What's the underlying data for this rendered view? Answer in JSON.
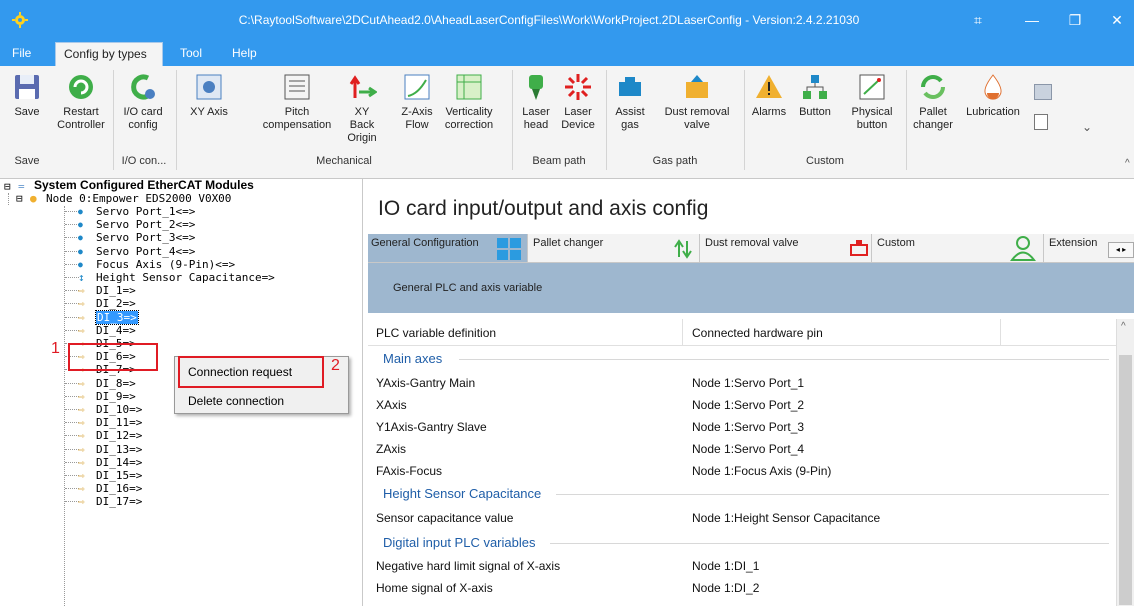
{
  "window": {
    "title": "C:\\RaytoolSoftware\\2DCutAhead2.0\\AheadLaserConfigFiles\\Work\\WorkProject.2DLaserConfig - Version:2.4.2.21030"
  },
  "menu": [
    "File",
    "Config by types",
    "Tool",
    "Help"
  ],
  "ribbon": {
    "buttons": [
      {
        "label": "Save",
        "icon": "save-icon"
      },
      {
        "label": "Restart Controller",
        "icon": "restart-icon"
      },
      {
        "label": "I/O card config",
        "icon": "io-card-icon"
      },
      {
        "label": "XY Axis",
        "icon": "xy-axis-icon"
      },
      {
        "label": "Pitch compensation",
        "icon": "pitch-icon"
      },
      {
        "label": "XY Back Origin",
        "icon": "back-origin-icon"
      },
      {
        "label": "Z-Axis Flow",
        "icon": "z-axis-icon"
      },
      {
        "label": "Verticality correction",
        "icon": "verticality-icon"
      },
      {
        "label": "Laser head",
        "icon": "laser-head-icon"
      },
      {
        "label": "Laser Device",
        "icon": "laser-device-icon"
      },
      {
        "label": "Assist gas",
        "icon": "assist-gas-icon"
      },
      {
        "label": "Dust removal valve",
        "icon": "dust-valve-icon"
      },
      {
        "label": "Alarms",
        "icon": "alarm-icon"
      },
      {
        "label": "Button",
        "icon": "button-icon"
      },
      {
        "label": "Physical button",
        "icon": "physical-button-icon"
      },
      {
        "label": "Pallet changer",
        "icon": "pallet-icon"
      },
      {
        "label": "Lubrication",
        "icon": "lubrication-icon"
      }
    ],
    "groups": [
      "Save",
      "I/O con...",
      "Mechanical",
      "Beam path",
      "Gas path",
      "Custom"
    ]
  },
  "tree": {
    "root": "System Configured EtherCAT Modules",
    "node": "Node 0:Empower EDS2000 V0X00",
    "items": [
      "Servo Port_1<=>",
      "Servo Port_2<=>",
      "Servo Port_3<=>",
      "Servo Port_4<=>",
      "Focus Axis (9-Pin)<=>",
      "Height Sensor Capacitance=>",
      "DI_1=>",
      "DI_2=>",
      "DI_3=>",
      "DI_4=>",
      "DI_5=>",
      "DI_6=>",
      "DI_7=>",
      "DI_8=>",
      "DI_9=>",
      "DI_10=>",
      "DI_11=>",
      "DI_12=>",
      "DI_13=>",
      "DI_14=>",
      "DI_15=>",
      "DI_16=>",
      "DI_17=>"
    ]
  },
  "context_menu": {
    "items": [
      "Connection request",
      "Delete connection"
    ]
  },
  "annotations": {
    "n1": "1",
    "n2": "2"
  },
  "panel": {
    "title": "IO card input/output and axis config",
    "tabs": [
      "General Configuration",
      "Pallet changer",
      "Dust removal valve",
      "Custom",
      "Extension"
    ],
    "subheader": "General PLC and axis variable",
    "columns": [
      "PLC variable definition",
      "Connected hardware pin"
    ],
    "sections": [
      {
        "title": "Main axes",
        "rows": [
          [
            "YAxis-Gantry Main",
            "Node 1:Servo Port_1"
          ],
          [
            "XAxis",
            "Node 1:Servo Port_2"
          ],
          [
            "Y1Axis-Gantry Slave",
            "Node 1:Servo Port_3"
          ],
          [
            "ZAxis",
            "Node 1:Servo Port_4"
          ],
          [
            "FAxis-Focus",
            "Node 1:Focus Axis (9-Pin)"
          ]
        ]
      },
      {
        "title": "Height Sensor Capacitance",
        "rows": [
          [
            "Sensor capacitance value",
            "Node 1:Height Sensor Capacitance"
          ]
        ]
      },
      {
        "title": "Digital input PLC variables",
        "rows": [
          [
            "Negative hard limit signal of X-axis",
            "Node 1:DI_1"
          ],
          [
            "Home signal of X-axis",
            "Node 1:DI_2"
          ]
        ]
      }
    ]
  }
}
